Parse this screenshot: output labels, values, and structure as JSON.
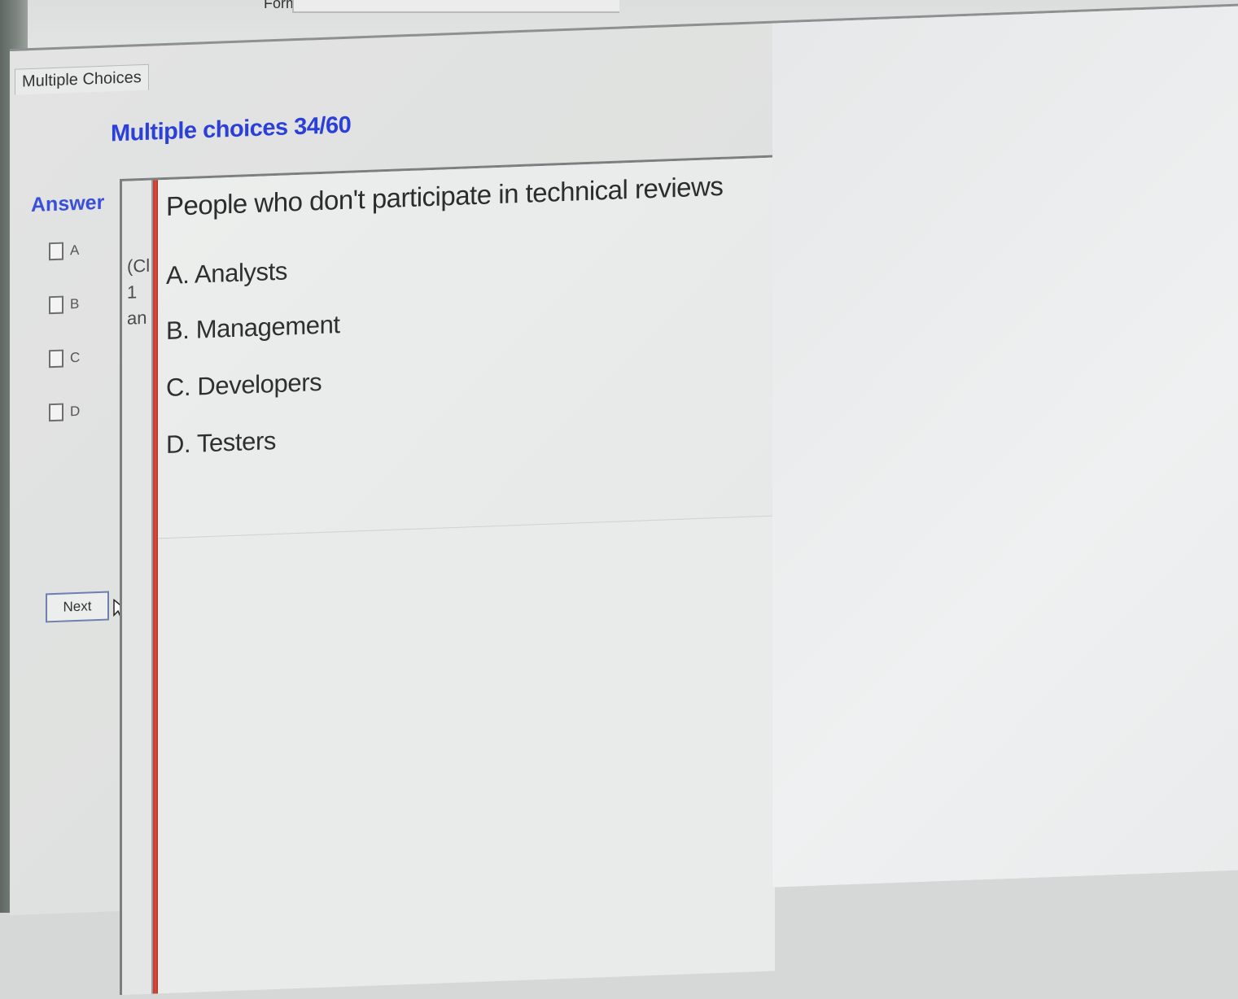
{
  "top_bar": {
    "partial_label": "Form"
  },
  "tab": {
    "label": "Multiple Choices"
  },
  "title": "Multiple choices 34/60",
  "answer_panel": {
    "title": "Answer",
    "options": [
      "A",
      "B",
      "C",
      "D"
    ],
    "next_label": "Next"
  },
  "instruction_snippet": {
    "line1": "(Cl",
    "line2": "1",
    "line3": "an"
  },
  "question": {
    "text": "People who don't participate in technical reviews",
    "choices": [
      "A. Analysts",
      "B. Management",
      "C. Developers",
      "D. Testers"
    ]
  },
  "colors": {
    "accent_title": "#2b3fd9",
    "divider": "#d94a3b"
  }
}
